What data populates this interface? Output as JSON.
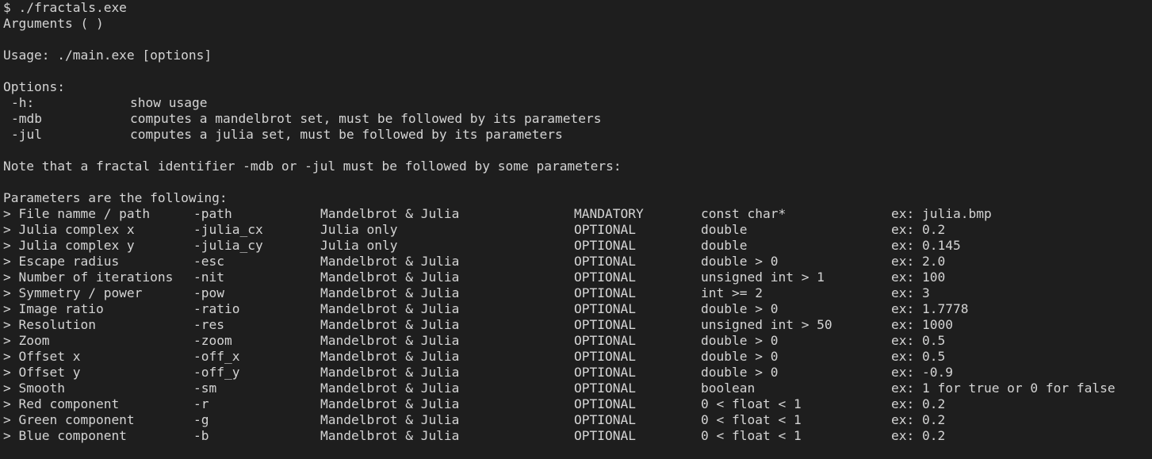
{
  "terminal": {
    "prompt_line": "$ ./fractals.exe",
    "arguments_line": "Arguments ( )",
    "usage_line": "Usage: ./main.exe [options]",
    "options_header": "Options:",
    "options": [
      {
        "flag": "-h:",
        "desc": "show usage"
      },
      {
        "flag": "-mdb",
        "desc": "computes a mandelbrot set, must be followed by its parameters"
      },
      {
        "flag": "-jul",
        "desc": "computes a julia set, must be followed by its parameters"
      }
    ],
    "note_line": "Note that a fractal identifier -mdb or -jul must be followed by some parameters:",
    "params_header": "Parameters are the following:",
    "params": [
      {
        "name": "> File namme / path",
        "flag": "-path",
        "scope": "Mandelbrot & Julia",
        "req": "MANDATORY",
        "type": "const char*",
        "ex": "ex: julia.bmp"
      },
      {
        "name": "> Julia complex x",
        "flag": "-julia_cx",
        "scope": "Julia only",
        "req": "OPTIONAL",
        "type": "double",
        "ex": "ex: 0.2"
      },
      {
        "name": "> Julia complex y",
        "flag": "-julia_cy",
        "scope": "Julia only",
        "req": "OPTIONAL",
        "type": "double",
        "ex": "ex: 0.145"
      },
      {
        "name": "> Escape radius",
        "flag": "-esc",
        "scope": "Mandelbrot & Julia",
        "req": "OPTIONAL",
        "type": "double > 0",
        "ex": "ex: 2.0"
      },
      {
        "name": "> Number of iterations",
        "flag": "-nit",
        "scope": "Mandelbrot & Julia",
        "req": "OPTIONAL",
        "type": "unsigned int > 1",
        "ex": "ex: 100"
      },
      {
        "name": "> Symmetry / power",
        "flag": "-pow",
        "scope": "Mandelbrot & Julia",
        "req": "OPTIONAL",
        "type": "int >= 2",
        "ex": "ex: 3"
      },
      {
        "name": "> Image ratio",
        "flag": "-ratio",
        "scope": "Mandelbrot & Julia",
        "req": "OPTIONAL",
        "type": "double > 0",
        "ex": "ex: 1.7778"
      },
      {
        "name": "> Resolution",
        "flag": "-res",
        "scope": "Mandelbrot & Julia",
        "req": "OPTIONAL",
        "type": "unsigned int > 50",
        "ex": "ex: 1000"
      },
      {
        "name": "> Zoom",
        "flag": "-zoom",
        "scope": "Mandelbrot & Julia",
        "req": "OPTIONAL",
        "type": "double > 0",
        "ex": "ex: 0.5"
      },
      {
        "name": "> Offset x",
        "flag": "-off_x",
        "scope": "Mandelbrot & Julia",
        "req": "OPTIONAL",
        "type": "double > 0",
        "ex": "ex: 0.5"
      },
      {
        "name": "> Offset y",
        "flag": "-off_y",
        "scope": "Mandelbrot & Julia",
        "req": "OPTIONAL",
        "type": "double > 0",
        "ex": "ex: -0.9"
      },
      {
        "name": "> Smooth",
        "flag": "-sm",
        "scope": "Mandelbrot & Julia",
        "req": "OPTIONAL",
        "type": "boolean",
        "ex": "ex: 1 for true or 0 for false"
      },
      {
        "name": "> Red component",
        "flag": "-r",
        "scope": "Mandelbrot & Julia",
        "req": "OPTIONAL",
        "type": "0 < float < 1",
        "ex": "ex: 0.2"
      },
      {
        "name": "> Green component",
        "flag": "-g",
        "scope": "Mandelbrot & Julia",
        "req": "OPTIONAL",
        "type": "0 < float < 1",
        "ex": "ex: 0.2"
      },
      {
        "name": "> Blue component",
        "flag": "-b",
        "scope": "Mandelbrot & Julia",
        "req": "OPTIONAL",
        "type": "0 < float < 1",
        "ex": "ex: 0.2"
      }
    ]
  },
  "colors": {
    "background": "#1e1e1e",
    "text": "#d4d4d4"
  }
}
